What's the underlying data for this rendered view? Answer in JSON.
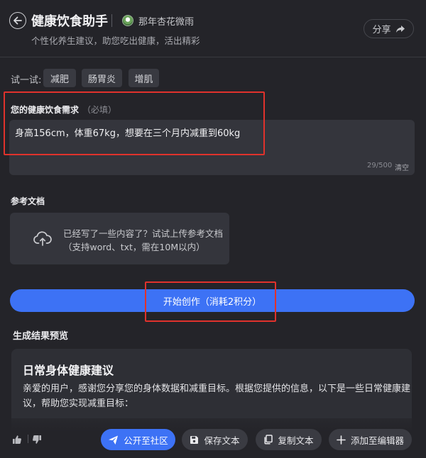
{
  "header": {
    "title": "健康饮食助手",
    "author": "那年杏花微雨",
    "subtitle": "个性化养生建议，助您吃出健康，活出精彩",
    "share_label": "分享"
  },
  "try": {
    "label": "试一试:",
    "tags": [
      "减肥",
      "肠胃炎",
      "增肌"
    ]
  },
  "requirement": {
    "label": "您的健康饮食需求",
    "hint": "（必填）",
    "value": "身高156cm，体重67kg，想要在三个月内减重到60kg",
    "count": "29/500",
    "clear_label": "清空"
  },
  "reference": {
    "label": "参考文档",
    "upload_text": "已经写了一些内容了？试试上传参考文档（支持word、txt，需在10M以内）"
  },
  "start_button": "开始创作（消耗2积分）",
  "result": {
    "label": "生成结果预览",
    "title": "日常身体健康建议",
    "body": "亲爱的用户，感谢您分享您的身体数据和减重目标。根据您提供的信息，以下是一些日常健康建议，帮助您实现减重目标："
  },
  "actions": {
    "publish": "公开至社区",
    "save": "保存文本",
    "copy": "复制文本",
    "add_editor": "添加至编辑器"
  },
  "colors": {
    "background": "#242429",
    "accent": "#3d72f5",
    "annotation_red": "#e0322c"
  }
}
